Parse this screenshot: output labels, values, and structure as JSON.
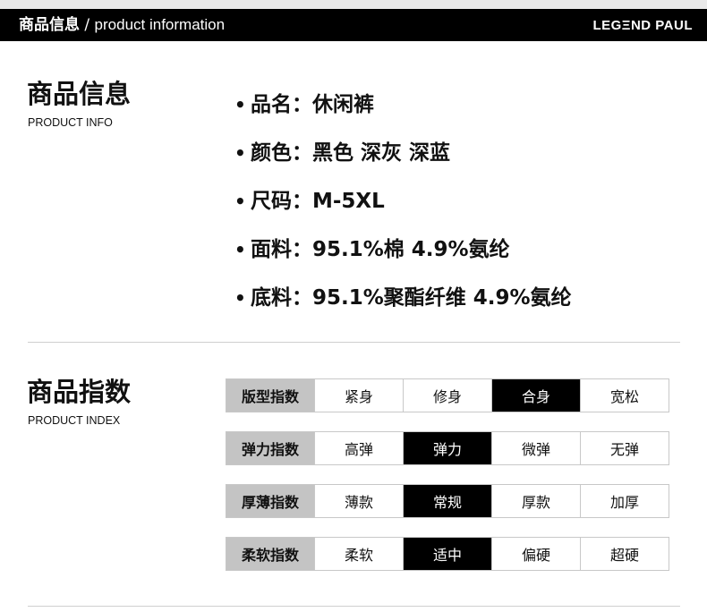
{
  "header": {
    "title_cn": "商品信息",
    "title_sep": " / ",
    "title_en": "product information",
    "brand": "LEGΞND PAUL"
  },
  "info": {
    "title": "商品信息",
    "subtitle": "PRODUCT INFO",
    "items": [
      {
        "label": "品名：",
        "value": "休闲裤"
      },
      {
        "label": "颜色：",
        "value": "黑色 深灰 深蓝"
      },
      {
        "label": "尺码：",
        "value": "M-5XL"
      },
      {
        "label": "面料：",
        "value": "95.1%棉 4.9%氨纶"
      },
      {
        "label": "底料：",
        "value": "95.1%聚酯纤维 4.9%氨纶"
      }
    ]
  },
  "index": {
    "title": "商品指数",
    "subtitle": "PRODUCT INDEX",
    "rows": [
      {
        "label": "版型指数",
        "options": [
          "紧身",
          "修身",
          "合身",
          "宽松"
        ],
        "selected": 2
      },
      {
        "label": "弹力指数",
        "options": [
          "高弹",
          "弹力",
          "微弹",
          "无弹"
        ],
        "selected": 1
      },
      {
        "label": "厚薄指数",
        "options": [
          "薄款",
          "常规",
          "厚款",
          "加厚"
        ],
        "selected": 1
      },
      {
        "label": "柔软指数",
        "options": [
          "柔软",
          "适中",
          "偏硬",
          "超硬"
        ],
        "selected": 1
      }
    ]
  },
  "colors": {
    "selected_bg": "#000000",
    "label_bg": "#c4c4c4"
  }
}
